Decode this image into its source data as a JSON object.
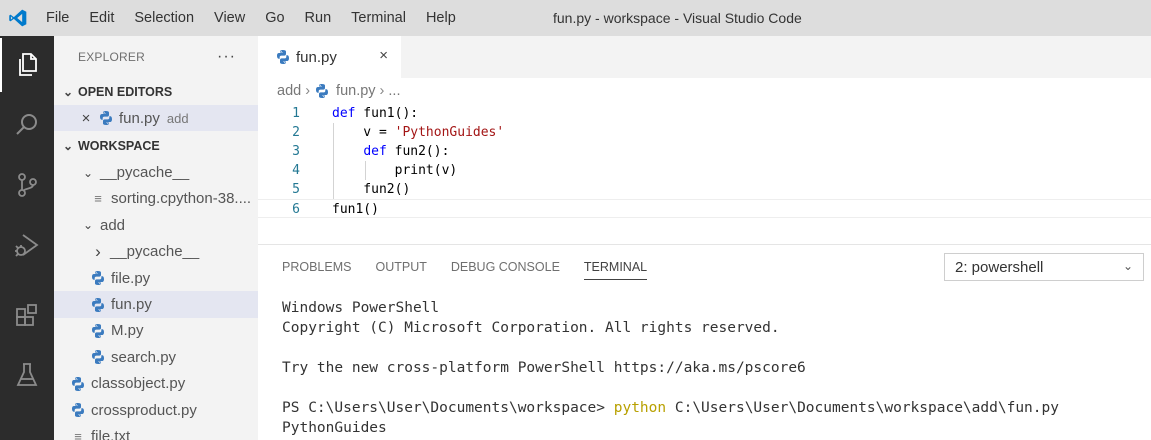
{
  "app": {
    "menu": [
      "File",
      "Edit",
      "Selection",
      "View",
      "Go",
      "Run",
      "Terminal",
      "Help"
    ],
    "window_title": "fun.py - workspace - Visual Studio Code"
  },
  "activity_bar": {
    "items": [
      "explorer-icon",
      "search-icon",
      "source-control-icon",
      "run-debug-icon",
      "extensions-icon",
      "testing-icon"
    ],
    "active": "explorer-icon"
  },
  "sidebar": {
    "title": "EXPLORER",
    "more": "···",
    "open_editors": {
      "label": "OPEN EDITORS",
      "items": [
        {
          "name": "fun.py",
          "desc": "add"
        }
      ]
    },
    "workspace": {
      "label": "WORKSPACE",
      "tree": [
        {
          "name": "__pycache__",
          "type": "folder",
          "expanded": true
        },
        {
          "name": "sorting.cpython-38....",
          "type": "file"
        },
        {
          "name": "add",
          "type": "folder",
          "expanded": true
        },
        {
          "name": "__pycache__",
          "type": "folder",
          "expanded": false
        },
        {
          "name": "file.py",
          "type": "python"
        },
        {
          "name": "fun.py",
          "type": "python",
          "selected": true
        },
        {
          "name": "M.py",
          "type": "python"
        },
        {
          "name": "search.py",
          "type": "python"
        },
        {
          "name": "classobject.py",
          "type": "python"
        },
        {
          "name": "crossproduct.py",
          "type": "python"
        },
        {
          "name": "file.txt",
          "type": "file"
        }
      ]
    }
  },
  "editor": {
    "tab": {
      "label": "fun.py",
      "close": "×"
    },
    "breadcrumb": [
      "add",
      "fun.py",
      "..."
    ],
    "lines": [
      {
        "n": "1",
        "tokens": [
          [
            "kw",
            "def"
          ],
          [
            "",
            " fun1():"
          ]
        ]
      },
      {
        "n": "2",
        "tokens": [
          [
            "",
            "    v = "
          ],
          [
            "str",
            "'PythonGuides'"
          ]
        ]
      },
      {
        "n": "3",
        "tokens": [
          [
            "",
            "    "
          ],
          [
            "kw",
            "def"
          ],
          [
            "",
            " fun2():"
          ]
        ]
      },
      {
        "n": "4",
        "tokens": [
          [
            "",
            "        print(v)"
          ]
        ]
      },
      {
        "n": "5",
        "tokens": [
          [
            "",
            "    fun2()"
          ]
        ]
      },
      {
        "n": "6",
        "tokens": [
          [
            "",
            "fun1()"
          ]
        ]
      }
    ]
  },
  "panel": {
    "tabs": [
      "PROBLEMS",
      "OUTPUT",
      "DEBUG CONSOLE",
      "TERMINAL"
    ],
    "active_tab": "TERMINAL",
    "terminal_select": "2: powershell",
    "terminal_lines": [
      "Windows PowerShell",
      "Copyright (C) Microsoft Corporation. All rights reserved.",
      "",
      "Try the new cross-platform PowerShell https://aka.ms/pscore6",
      ""
    ],
    "prompt": {
      "path": "PS C:\\Users\\User\\Documents\\workspace> ",
      "command": "python",
      "args": " C:\\Users\\User\\Documents\\workspace\\add\\fun.py"
    },
    "output": "PythonGuides"
  },
  "colors": {
    "accent": "#007acc",
    "python_icon": "#3b7bbf",
    "keyword": "#0000ff",
    "string": "#a31515",
    "line_number": "#237893",
    "activity_bar": "#2c2c2c"
  }
}
